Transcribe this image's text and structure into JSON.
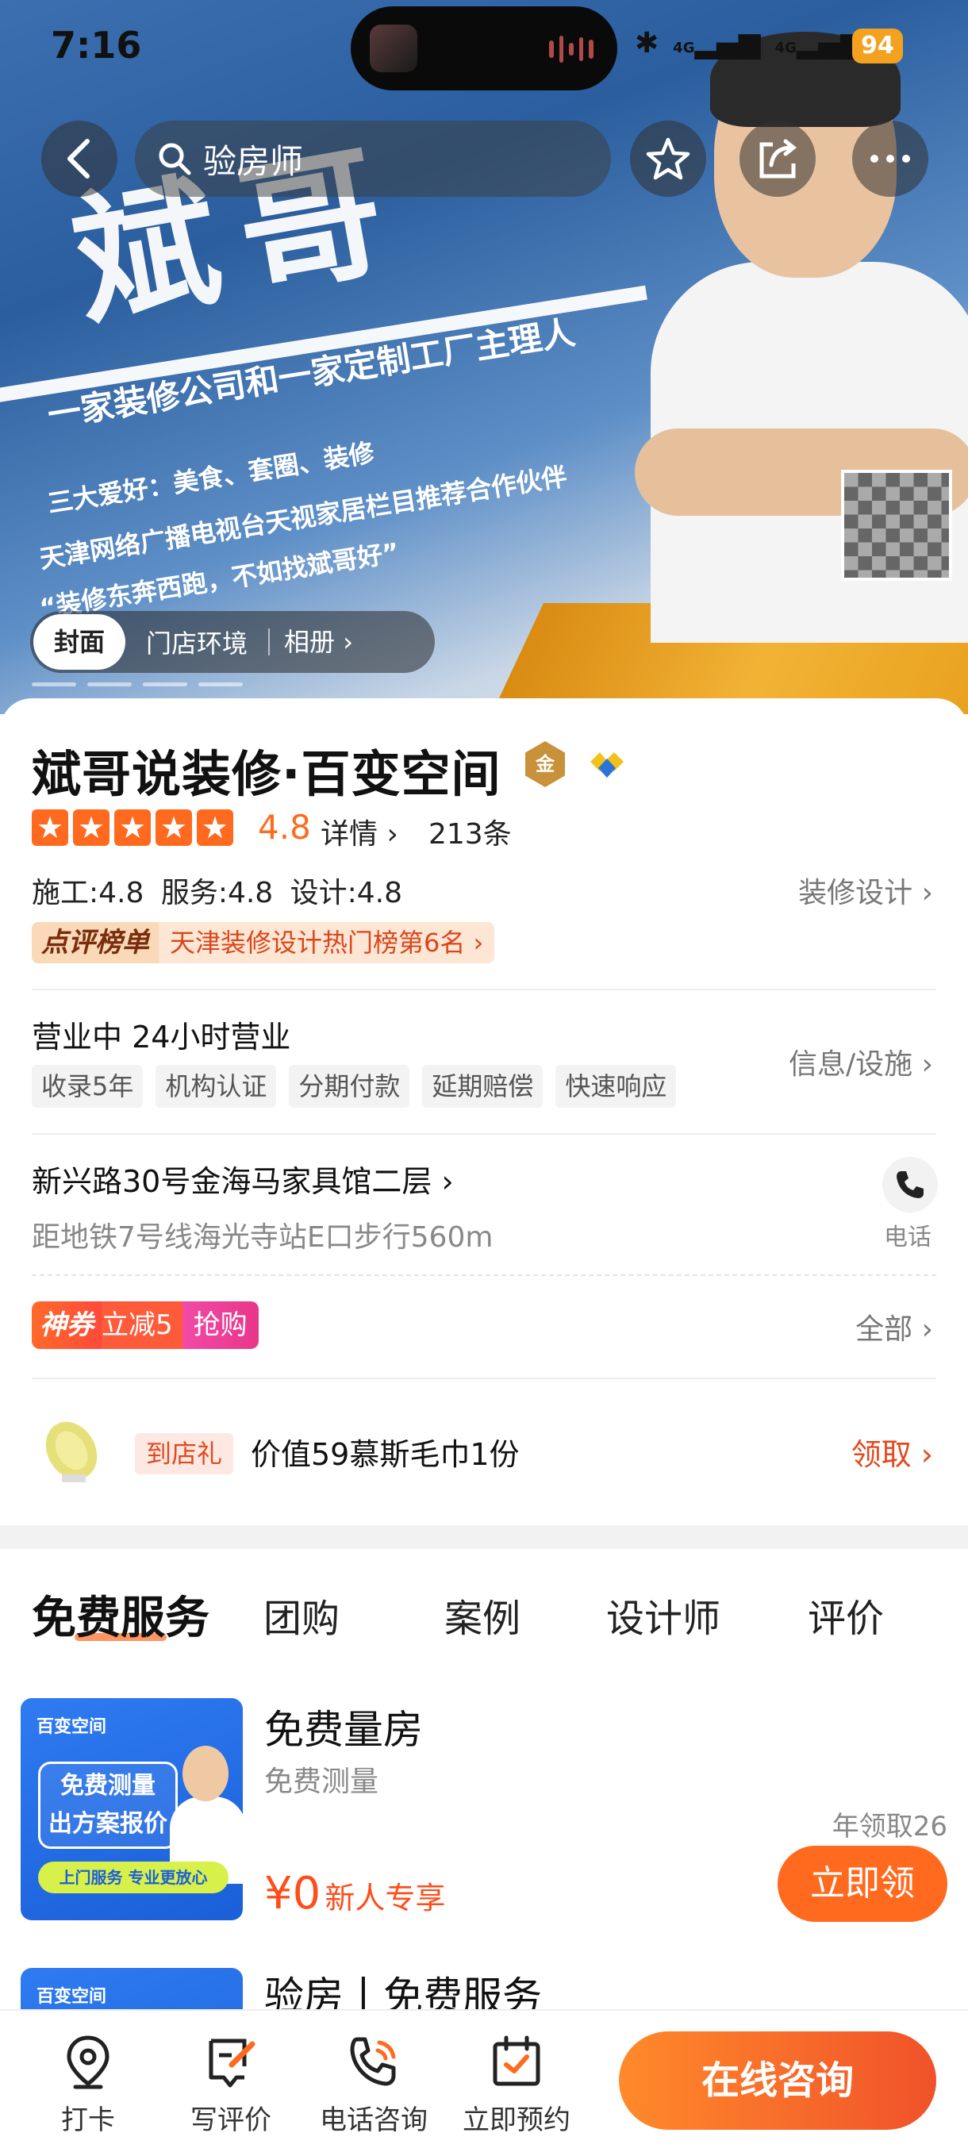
{
  "status_bar": {
    "time": "7:16",
    "battery": "94",
    "signal_1": "4G",
    "signal_2": "4G"
  },
  "top_bar": {
    "search_text": "验房师"
  },
  "hero": {
    "headline": "斌哥",
    "line1": "一家装修公司和一家定制工厂主理人",
    "line2": "三大爱好：美食、套圈、装修",
    "line3": "天津网络广播电视台天视家居栏目推荐合作伙伴",
    "line4": "“装修东奔西跑，不如找斌哥好”"
  },
  "album_tabs": {
    "cover": "封面",
    "store_env": "门店环境",
    "album": "相册"
  },
  "shop": {
    "name": "斌哥说装修·百变空间",
    "gold_badge": "金",
    "rating": "4.8",
    "details_link": "详情",
    "review_count": "213条",
    "scores": "施工:4.8  服务:4.8  设计:4.8",
    "category_link": "装修设计",
    "rank_key": "点评榜单",
    "rank_value": "天津装修设计热门榜第6名",
    "hours": "营业中 24小时营业",
    "tags": [
      "收录5年",
      "机构认证",
      "分期付款",
      "延期赔偿",
      "快速响应"
    ],
    "info_link": "信息/设施",
    "address": "新兴路30号金海马家具馆二层",
    "metro": "距地铁7号线海光寺站E口步行560m",
    "phone_label": "电话",
    "coupon": {
      "brand": "神券",
      "discount": "立减5",
      "action": "抢购"
    },
    "all_link": "全部",
    "gift_tag": "到店礼",
    "gift_text": "价值59慕斯毛巾1份",
    "claim_link": "领取"
  },
  "tabs": [
    "免费服务",
    "团购",
    "案例",
    "设计师",
    "评价"
  ],
  "products": [
    {
      "title": "免费量房",
      "subtitle": "免费测量",
      "stat": "年领取26",
      "price": "¥0",
      "price_note": "新人专享",
      "button": "立即领",
      "img_brand": "百变空间",
      "img_box": "免费测量\n出方案报价",
      "img_strip": "上门服务 专业更放心"
    },
    {
      "title": "验房丨免费服务",
      "img_brand": "百变空间"
    }
  ],
  "bottom_bar": {
    "checkin": "打卡",
    "write_review": "写评价",
    "phone_consult": "电话咨询",
    "book": "立即预约",
    "online_consult": "在线咨询"
  },
  "colors": {
    "accent": "#ff6a1f",
    "link_red": "#e2491f",
    "pink": "#e8368a"
  }
}
